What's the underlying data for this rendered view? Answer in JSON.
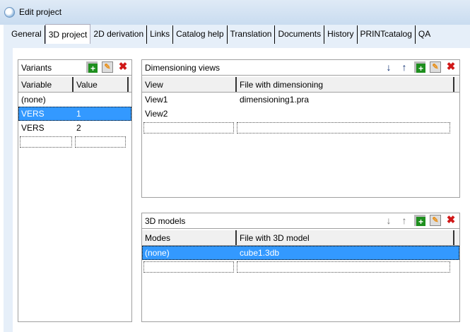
{
  "window": {
    "title": "Edit project"
  },
  "tabs": [
    "General",
    "3D project",
    "2D derivation",
    "Links",
    "Catalog help",
    "Translation",
    "Documents",
    "History",
    "PRINTcatalog",
    "QA"
  ],
  "variants": {
    "title": "Variants",
    "columns": [
      "Variable",
      "Value"
    ],
    "rows": [
      [
        "(none)",
        ""
      ],
      [
        "VERS",
        "1"
      ],
      [
        "VERS",
        "2"
      ]
    ],
    "selected_row": 1
  },
  "dimensioning": {
    "title": "Dimensioning views",
    "columns": [
      "View",
      "File with dimensioning"
    ],
    "rows": [
      [
        "View1",
        "dimensioning1.pra"
      ],
      [
        "View2",
        ""
      ]
    ]
  },
  "models": {
    "title": "3D models",
    "columns": [
      "Modes",
      "File with 3D model"
    ],
    "rows": [
      [
        "(none)",
        "cube1.3db"
      ]
    ],
    "selected_row": 0
  },
  "icons": {
    "down": "↓",
    "up": "↑",
    "add": "+",
    "edit": "✎",
    "delete": "✖"
  }
}
